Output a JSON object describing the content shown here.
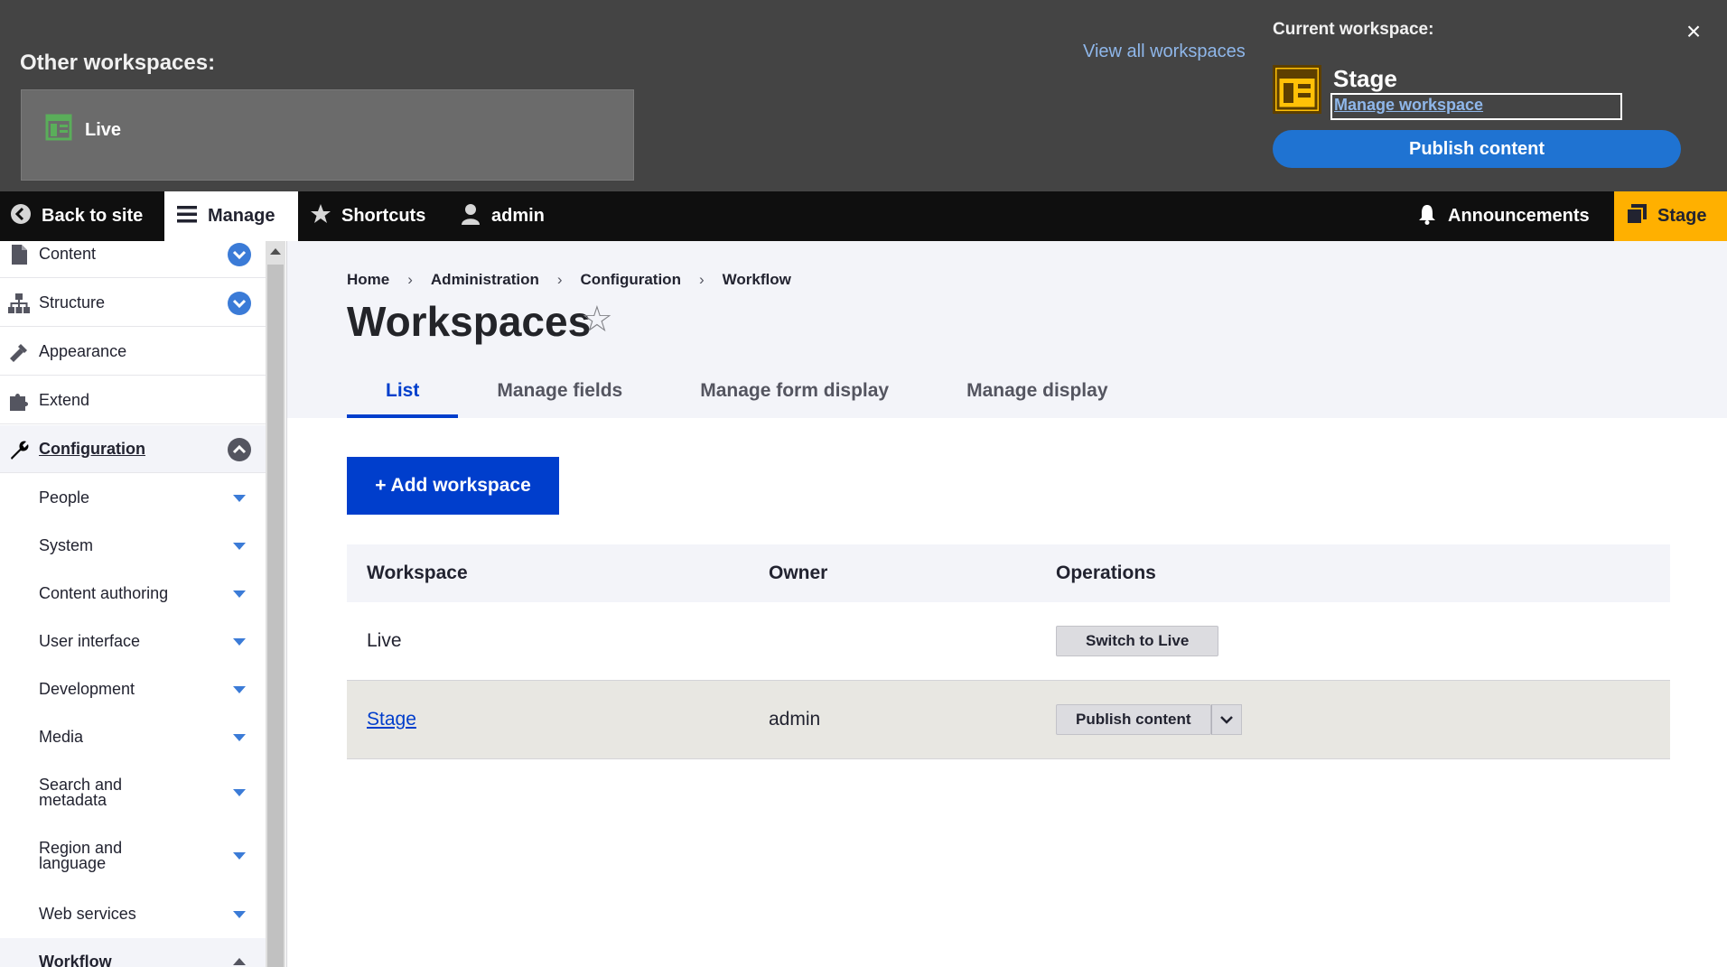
{
  "workspace_tray": {
    "other_title": "Other workspaces:",
    "live_label": "Live",
    "view_all": "View all workspaces",
    "current_title": "Current workspace:",
    "close": "×",
    "current_name": "Stage",
    "manage_link": "Manage workspace",
    "publish": "Publish content",
    "colors": {
      "tray_bg": "#444444",
      "publish_bg": "#1f73d2",
      "stage_icon": "#ffc107"
    }
  },
  "toolbar": {
    "back": "Back to site",
    "manage": "Manage",
    "shortcuts": "Shortcuts",
    "user": "admin",
    "announcements": "Announcements",
    "workspace": "Stage"
  },
  "sidebar": {
    "top_items": [
      {
        "label": "Content",
        "icon": "file-icon"
      },
      {
        "label": "Structure",
        "icon": "sitemap-icon"
      },
      {
        "label": "Appearance",
        "icon": "paintbrush-icon"
      },
      {
        "label": "Extend",
        "icon": "puzzle-icon"
      },
      {
        "label": "Configuration",
        "icon": "wrench-icon"
      }
    ],
    "sub_items": [
      "People",
      "System",
      "Content authoring",
      "User interface",
      "Development",
      "Media",
      "Search and metadata",
      "Region and language",
      "Web services",
      "Workflow"
    ]
  },
  "main": {
    "breadcrumb": [
      "Home",
      "Administration",
      "Configuration",
      "Workflow"
    ],
    "breadcrumb_sep": "›",
    "title": "Workspaces",
    "star": "☆",
    "tabs": [
      "List",
      "Manage fields",
      "Manage form display",
      "Manage display"
    ],
    "add_button": "+ Add workspace",
    "table": {
      "headers": [
        "Workspace",
        "Owner",
        "Operations"
      ],
      "rows": [
        {
          "workspace": "Live",
          "owner": "",
          "operation": "Switch to Live"
        },
        {
          "workspace": "Stage",
          "owner": "admin",
          "operation": "Publish content"
        }
      ]
    },
    "colors": {
      "primary": "#003ecc",
      "stage_toolbar": "#ffb000"
    }
  }
}
